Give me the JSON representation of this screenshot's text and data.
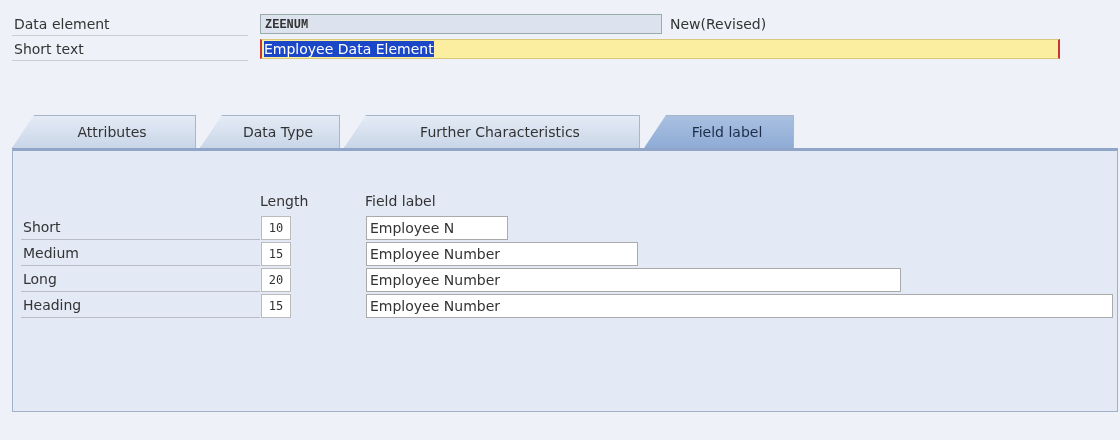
{
  "header": {
    "data_element": {
      "label": "Data element",
      "value": "ZEENUM",
      "status": "New(Revised)"
    },
    "short_text": {
      "label": "Short text",
      "value": "Employee Data Element",
      "text_selected": true
    }
  },
  "tabs": [
    {
      "label": "Attributes",
      "selected": false
    },
    {
      "label": "Data Type",
      "selected": false
    },
    {
      "label": "Further Characteristics",
      "selected": false
    },
    {
      "label": "Field label",
      "selected": true
    }
  ],
  "field_labels": {
    "length_heading": "Length",
    "label_heading": "Field label",
    "rows": [
      {
        "name": "Short",
        "length": "10",
        "label": "Employee N"
      },
      {
        "name": "Medium",
        "length": "15",
        "label": "Employee Number"
      },
      {
        "name": "Long",
        "length": "20",
        "label": "Employee Number"
      },
      {
        "name": "Heading",
        "length": "15",
        "label": "Employee Number"
      }
    ]
  }
}
